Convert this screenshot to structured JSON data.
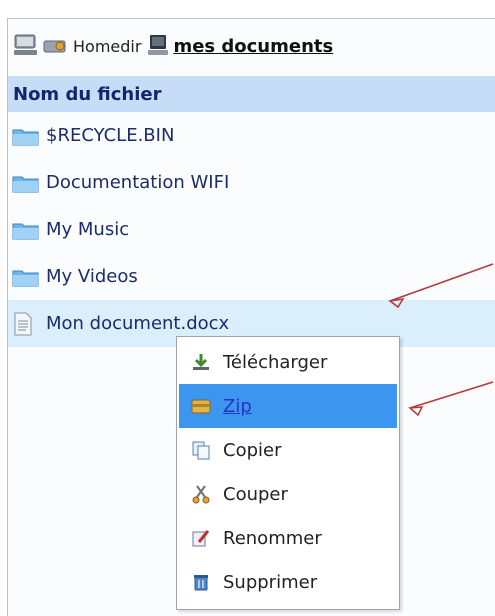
{
  "breadcrumb": {
    "home_label": "Homedir",
    "current_label": "mes documents"
  },
  "table": {
    "column_header": "Nom du fichier",
    "rows": [
      {
        "name": "$RECYCLE.BIN",
        "icon": "folder-icon"
      },
      {
        "name": "Documentation WIFI",
        "icon": "folder-icon"
      },
      {
        "name": "My Music",
        "icon": "folder-icon"
      },
      {
        "name": "My Videos",
        "icon": "folder-icon"
      },
      {
        "name": "Mon document.docx",
        "icon": "document-icon",
        "selected": true
      }
    ]
  },
  "context_menu": {
    "items": [
      {
        "label": "Télécharger",
        "icon": "download-icon"
      },
      {
        "label": "Zip",
        "icon": "zip-icon",
        "highlighted": true
      },
      {
        "label": "Copier",
        "icon": "copy-icon"
      },
      {
        "label": "Couper",
        "icon": "cut-icon"
      },
      {
        "label": "Renommer",
        "icon": "rename-icon"
      },
      {
        "label": "Supprimer",
        "icon": "delete-icon"
      }
    ]
  },
  "colors": {
    "header_bg": "#c6dcf7",
    "selected_row_bg": "#daeefc",
    "menu_highlight_bg": "#3c95ee",
    "annotation_arrow": "#b03a3a"
  }
}
